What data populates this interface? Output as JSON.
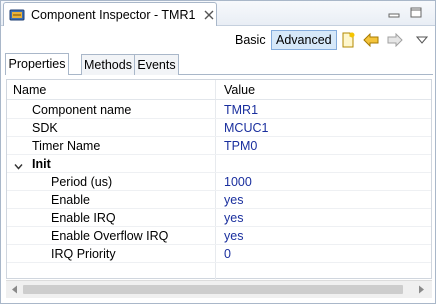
{
  "window": {
    "title": "Component Inspector - TMR1"
  },
  "toolbar": {
    "basic_label": "Basic",
    "advanced_label": "Advanced",
    "icons": [
      "new-component-icon",
      "back-arrow-icon",
      "forward-arrow-icon",
      "view-menu-icon"
    ]
  },
  "tabs": [
    {
      "label": "Properties",
      "active": true
    },
    {
      "label": "Methods",
      "active": false
    },
    {
      "label": "Events",
      "active": false
    }
  ],
  "table": {
    "col_name": "Name",
    "col_value": "Value",
    "rows": [
      {
        "name": "Component name",
        "value": "TMR1"
      },
      {
        "name": "SDK",
        "value": "MCUC1"
      },
      {
        "name": "Timer Name",
        "value": "TPM0"
      },
      {
        "name": "Init",
        "value": "",
        "group": true,
        "expanded": true
      },
      {
        "name": "Period (us)",
        "value": "1000"
      },
      {
        "name": "Enable",
        "value": "yes"
      },
      {
        "name": "Enable IRQ",
        "value": "yes"
      },
      {
        "name": "Enable Overflow IRQ",
        "value": "yes"
      },
      {
        "name": "IRQ Priority",
        "value": "0"
      }
    ]
  },
  "colors": {
    "value_text": "#1a2f9e",
    "advanced_bg": "#d6e8f9",
    "border": "#a9b7c9"
  }
}
